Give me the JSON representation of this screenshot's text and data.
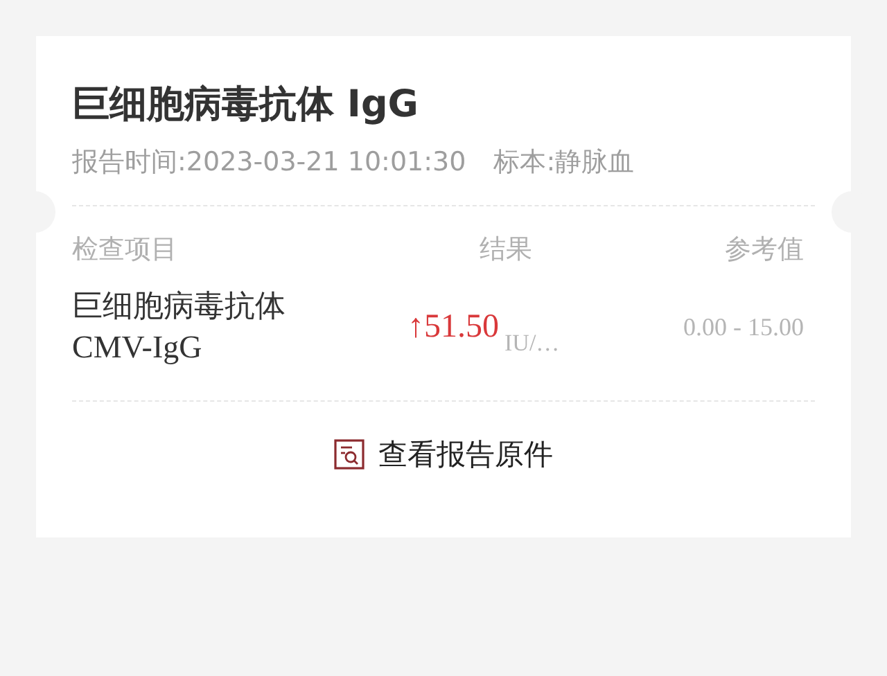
{
  "report": {
    "title": "巨细胞病毒抗体 IgG",
    "report_time": "报告时间:2023-03-21 10:01:30",
    "specimen": "标本:静脉血"
  },
  "table": {
    "columns": [
      "检查项目",
      "结果",
      "参考值"
    ],
    "rows": [
      {
        "name": "巨细胞病毒抗体",
        "code": "CMV-IgG",
        "result": "↑51.50",
        "unit": "IU/…",
        "abnormal": true,
        "reference": "0.00 - 15.00"
      }
    ]
  },
  "view_original": {
    "label": "查看报告原件"
  }
}
